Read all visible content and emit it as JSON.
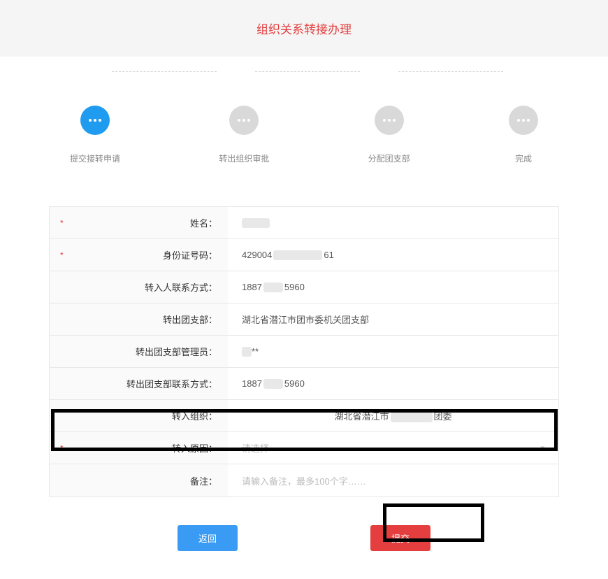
{
  "page_title": "组织关系转接办理",
  "steps": [
    {
      "label": "提交接转申请",
      "active": true
    },
    {
      "label": "转出组织审批",
      "active": false
    },
    {
      "label": "分配团支部",
      "active": false
    },
    {
      "label": "完成",
      "active": false
    }
  ],
  "form": {
    "name": {
      "label": "姓名：",
      "value": "",
      "required": true
    },
    "id_number": {
      "label": "身份证号码：",
      "value_prefix": "429004",
      "value_suffix": "61",
      "required": true
    },
    "transfer_in_contact": {
      "label": "转入人联系方式：",
      "value_prefix": "1887",
      "value_suffix": "5960",
      "required": false
    },
    "transfer_out_branch": {
      "label": "转出团支部：",
      "value": "湖北省潜江市团市委机关团支部",
      "required": false
    },
    "transfer_out_admin": {
      "label": "转出团支部管理员：",
      "value_suffix": "**",
      "required": false
    },
    "transfer_out_contact": {
      "label": "转出团支部联系方式：",
      "value_prefix": "1887",
      "value_suffix": "5960",
      "required": false
    },
    "transfer_in_org": {
      "label": "转入组织：",
      "value_prefix": "湖北省潜江市",
      "value_suffix": "团委",
      "required": false
    },
    "transfer_reason": {
      "label": "转入原因：",
      "placeholder": "请选择",
      "required": true
    },
    "remark": {
      "label": "备注：",
      "placeholder": "请输入备注，最多100个字……",
      "required": false
    }
  },
  "buttons": {
    "back": "返回",
    "submit": "提交"
  }
}
